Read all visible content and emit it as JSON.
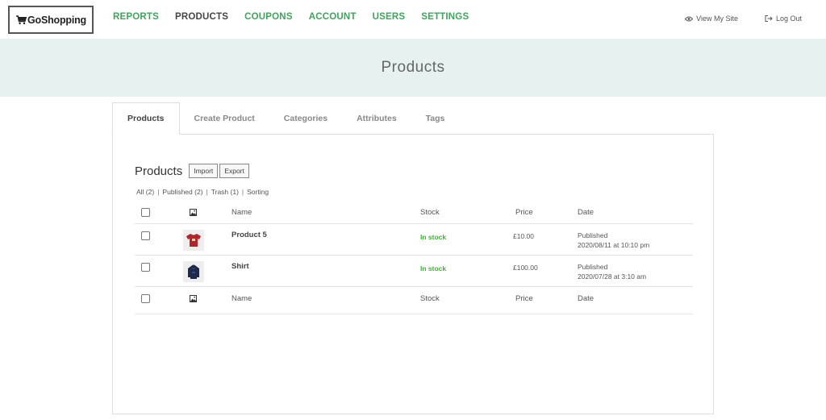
{
  "brand": {
    "name": "GoShopping"
  },
  "nav": {
    "items": [
      {
        "label": "REPORTS",
        "active": false
      },
      {
        "label": "PRODUCTS",
        "active": true
      },
      {
        "label": "COUPONS",
        "active": false
      },
      {
        "label": "ACCOUNT",
        "active": false
      },
      {
        "label": "USERS",
        "active": false
      },
      {
        "label": "SETTINGS",
        "active": false
      }
    ],
    "view_site": "View My Site",
    "log_out": "Log Out"
  },
  "hero": {
    "title": "Products"
  },
  "tabs": [
    {
      "label": "Products",
      "active": true
    },
    {
      "label": "Create Product",
      "active": false
    },
    {
      "label": "Categories",
      "active": false
    },
    {
      "label": "Attributes",
      "active": false
    },
    {
      "label": "Tags",
      "active": false
    }
  ],
  "panel": {
    "title": "Products",
    "import_label": "Import",
    "export_label": "Export",
    "filters": [
      "All (2)",
      "Published (2)",
      "Trash (1)",
      "Sorting"
    ]
  },
  "table": {
    "headers": {
      "name": "Name",
      "stock": "Stock",
      "price": "Price",
      "date": "Date"
    },
    "rows": [
      {
        "name": "Product 5",
        "stock": "In stock",
        "price": "£10.00",
        "status": "Published",
        "date": "2020/08/11 at 10:10 pm",
        "thumb": "red-tshirt"
      },
      {
        "name": "Shirt",
        "stock": "In stock",
        "price": "£100.00",
        "status": "Published",
        "date": "2020/07/28 at 3:10 am",
        "thumb": "navy-hoodie"
      }
    ]
  },
  "colors": {
    "accent_green": "#3ea65a",
    "stock_green": "#44b03a",
    "hero_bg": "#e7f2f0"
  }
}
